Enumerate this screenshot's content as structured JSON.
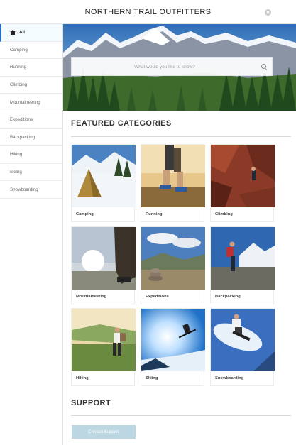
{
  "app": {
    "title": "NORTHERN TRAIL OUTFITTERS"
  },
  "sidebar": {
    "items": [
      {
        "label": "All",
        "icon": "home-icon",
        "active": true
      },
      {
        "label": "Camping"
      },
      {
        "label": "Running"
      },
      {
        "label": "Climbing"
      },
      {
        "label": "Mountaineering"
      },
      {
        "label": "Expeditions"
      },
      {
        "label": "Backpacking"
      },
      {
        "label": "Hiking"
      },
      {
        "label": "Skiing"
      },
      {
        "label": "Snowboarding"
      }
    ]
  },
  "search": {
    "placeholder": "What would you like to know?"
  },
  "featured": {
    "title": "FEATURED CATEGORIES",
    "categories": [
      {
        "label": "Camping"
      },
      {
        "label": "Running"
      },
      {
        "label": "Climbing"
      },
      {
        "label": "Mountaineering"
      },
      {
        "label": "Expeditions"
      },
      {
        "label": "Backpacking"
      },
      {
        "label": "Hiking"
      },
      {
        "label": "Skiing"
      },
      {
        "label": "Snowboarding"
      }
    ]
  },
  "support": {
    "title": "SUPPORT",
    "button_label": "Contact Support"
  },
  "colors": {
    "accent": "#2a6ac0",
    "support_button": "#bcd6e2"
  }
}
